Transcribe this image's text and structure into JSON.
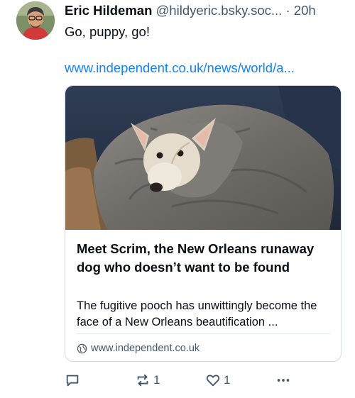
{
  "post": {
    "author_name": "Eric Hildeman",
    "author_handle": "@hildyeric.bsky.soc...",
    "separator": "·",
    "time": "20h",
    "text": "Go, puppy, go!",
    "link_text": "www.independent.co.uk/news/world/a..."
  },
  "card": {
    "title": "Meet Scrim, the New Orleans runaway dog who doesn’t want to be found",
    "description": "The fugitive pooch has unwittingly become the face of a New Orleans beautification ...",
    "domain": "www.independent.co.uk",
    "domain_icon": "globe-icon"
  },
  "actions": {
    "reply_icon": "reply-icon",
    "repost_icon": "repost-icon",
    "repost_count": "1",
    "like_icon": "heart-icon",
    "like_count": "1",
    "more_icon": "more-icon"
  },
  "colors": {
    "link": "#1083fe",
    "muted": "#42576c",
    "text": "#0b0f14",
    "border": "#d4dbe2"
  }
}
